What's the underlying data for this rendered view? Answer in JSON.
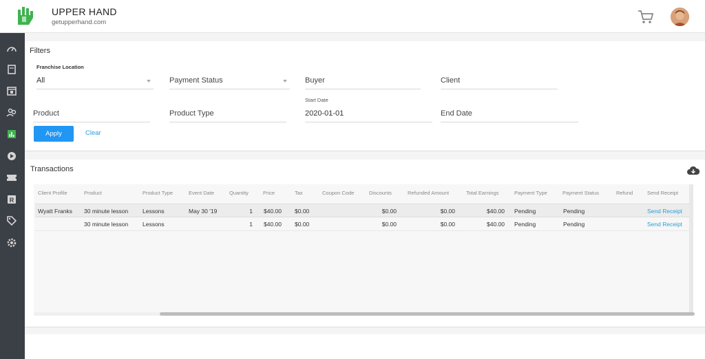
{
  "header": {
    "brand_name": "UPPER HAND",
    "brand_url": "getupperhand.com",
    "icons": {
      "logo": "upper-hand-logo",
      "cart": "cart-icon",
      "avatar": "user-avatar"
    },
    "accent_color": "#3fb34f"
  },
  "sidebar": {
    "items": [
      {
        "name": "dashboard-icon"
      },
      {
        "name": "book-icon"
      },
      {
        "name": "calendar-icon"
      },
      {
        "name": "users-icon"
      },
      {
        "name": "reports-icon",
        "active": true
      },
      {
        "name": "marketing-icon"
      },
      {
        "name": "ticket-icon"
      },
      {
        "name": "resources-icon"
      },
      {
        "name": "tag-icon"
      },
      {
        "name": "settings-icon"
      }
    ]
  },
  "filters": {
    "title": "Filters",
    "franchise_location": {
      "label": "Franchise Location",
      "value": "All"
    },
    "payment_status": {
      "placeholder": "Payment Status"
    },
    "buyer": {
      "placeholder": "Buyer"
    },
    "client": {
      "placeholder": "Client"
    },
    "product": {
      "placeholder": "Product"
    },
    "product_type": {
      "placeholder": "Product Type"
    },
    "start_date": {
      "label": "Start Date",
      "value": "2020-01-01"
    },
    "end_date": {
      "placeholder": "End Date"
    },
    "apply_label": "Apply",
    "clear_label": "Clear",
    "apply_color": "#2196f3"
  },
  "transactions": {
    "title": "Transactions",
    "download_icon": "cloud-download-icon",
    "columns": [
      "Client Profile",
      "Product",
      "Product Type",
      "Event Date",
      "Quantity",
      "Price",
      "Tax",
      "Coupon Code",
      "Discounts",
      "Refunded Amount",
      "Total Earnings",
      "Payment Type",
      "Payment Status",
      "Refund",
      "Send Receipt"
    ],
    "rows": [
      {
        "client": "Wyatt Franks",
        "product": "30 minute lesson",
        "product_type": "Lessons",
        "event_date": "May 30 '19",
        "quantity": "1",
        "price": "$40.00",
        "tax": "$0.00",
        "coupon": "",
        "discounts": "$0.00",
        "refunded": "$0.00",
        "total": "$40.00",
        "payment_type": "Pending",
        "payment_status": "Pending",
        "refund": "",
        "send_receipt": "Send Receipt"
      },
      {
        "client": "",
        "product": "30 minute lesson",
        "product_type": "Lessons",
        "event_date": "",
        "quantity": "1",
        "price": "$40.00",
        "tax": "$0.00",
        "coupon": "",
        "discounts": "$0.00",
        "refunded": "$0.00",
        "total": "$40.00",
        "payment_type": "Pending",
        "payment_status": "Pending",
        "refund": "",
        "send_receipt": "Send Receipt"
      }
    ],
    "link_color": "#2a9fd8"
  }
}
